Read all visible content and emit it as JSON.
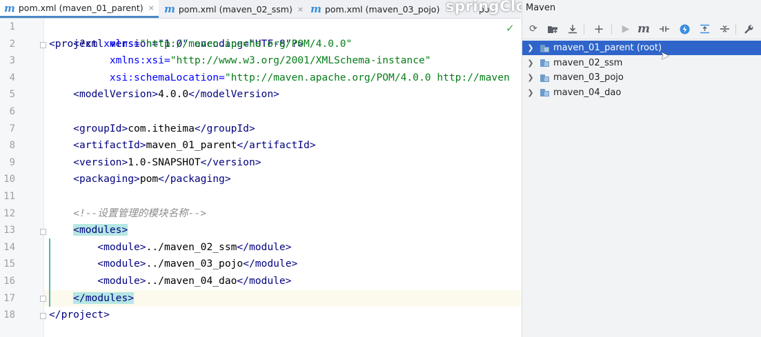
{
  "tabs": [
    {
      "icon": "maven-m-icon",
      "label": "pom.xml (maven_01_parent)",
      "close": "×",
      "active": true
    },
    {
      "icon": "maven-m-icon",
      "label": "pom.xml (maven_02_ssm)",
      "close": "×",
      "active": false
    },
    {
      "icon": "maven-m-icon",
      "label": "pom.xml (maven_03_pojo)",
      "active": false
    }
  ],
  "tab_overflow": "po",
  "watermark": "springCloud",
  "maven_panel": {
    "title": "Maven",
    "toolbar": [
      "refresh-icon",
      "add-folder-icon",
      "download-icon",
      "plus-icon",
      "run-icon",
      "execute-goal-icon",
      "toggle-offline-icon",
      "lightning-icon",
      "collapse-all-icon",
      "expand-all-icon",
      "wrench-icon"
    ],
    "tree": [
      {
        "label": "maven_01_parent (root)",
        "selected": true
      },
      {
        "label": "maven_02_ssm",
        "selected": false
      },
      {
        "label": "maven_03_pojo",
        "selected": false
      },
      {
        "label": "maven_04_dao",
        "selected": false
      }
    ]
  },
  "editor": {
    "status_check": "✓",
    "line_numbers": [
      "1",
      "2",
      "3",
      "4",
      "5",
      "6",
      "7",
      "8",
      "9",
      "10",
      "11",
      "12",
      "13",
      "14",
      "15",
      "16",
      "17",
      "18"
    ],
    "lines": {
      "l1": {
        "decl": "<?xml version=\"1.0\" encoding=\"UTF-8\"?>"
      },
      "l2": {
        "open": "<project ",
        "attr": "xmlns=",
        "val": "\"http://maven.apache.org/POM/4.0.0\""
      },
      "l3": {
        "attr": "xmlns:xsi=",
        "val": "\"http://www.w3.org/2001/XMLSchema-instance\""
      },
      "l4": {
        "attr": "xsi:schemaLocation=",
        "val": "\"http://maven.apache.org/POM/4.0.0 http://maven"
      },
      "l5": {
        "open": "<modelVersion>",
        "text": "4.0.0",
        "close": "</modelVersion>"
      },
      "l7": {
        "open": "<groupId>",
        "text": "com.itheima",
        "close": "</groupId>"
      },
      "l8": {
        "open": "<artifactId>",
        "text": "maven_01_parent",
        "close": "</artifactId>"
      },
      "l9": {
        "open": "<version>",
        "text": "1.0-SNAPSHOT",
        "close": "</version>"
      },
      "l10": {
        "open": "<packaging>",
        "text": "pom",
        "close": "</packaging>"
      },
      "l12": {
        "comment": "<!--设置管理的模块名称-->"
      },
      "l13": {
        "open": "<modules>"
      },
      "l14": {
        "open": "<module>",
        "text": "../maven_02_ssm",
        "close": "</module>"
      },
      "l15": {
        "open": "<module>",
        "text": "../maven_03_pojo",
        "close": "</module>"
      },
      "l16": {
        "open": "<module>",
        "text": "../maven_04_dao",
        "close": "</module>"
      },
      "l17": {
        "close": "</modules>"
      },
      "l18": {
        "close": "</project>"
      }
    }
  },
  "colors": {
    "accent": "#3a8de0",
    "selection": "#2f65ca",
    "tag": "#000080",
    "string": "#067d17",
    "attribute": "#0000ff",
    "match_highlight": "#b5e7e3"
  }
}
